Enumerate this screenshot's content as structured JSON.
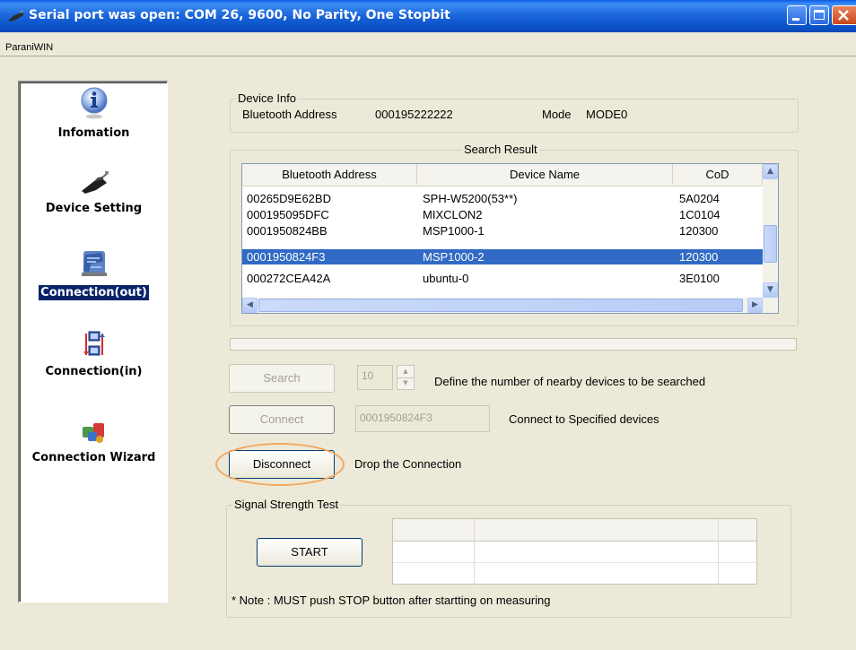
{
  "window": {
    "title": "Serial port was open: COM 26, 9600, No Parity, One Stopbit",
    "menu_item": "ParaniWIN"
  },
  "sidebar": {
    "items": [
      {
        "label": "Infomation",
        "icon": "info-icon"
      },
      {
        "label": "Device Setting",
        "icon": "device-icon"
      },
      {
        "label": "Connection(out)",
        "icon": "connection-out-icon",
        "active": true
      },
      {
        "label": "Connection(in)",
        "icon": "connection-in-icon"
      },
      {
        "label": "Connection Wizard",
        "icon": "wizard-icon"
      }
    ]
  },
  "device_info": {
    "legend": "Device Info",
    "address_label": "Bluetooth Address",
    "address_value": "000195222222",
    "mode_label": "Mode",
    "mode_value": "MODE0"
  },
  "search_result": {
    "legend": "Search Result",
    "columns": [
      "Bluetooth Address",
      "Device Name",
      "CoD"
    ],
    "rows": [
      {
        "address": "00265D9E62BD",
        "name": "SPH-W5200(53**)",
        "cod": "5A0204",
        "selected": false
      },
      {
        "address": "000195095DFC",
        "name": "MIXCLON2",
        "cod": "1C0104",
        "selected": false
      },
      {
        "address": "0001950824BB",
        "name": "MSP1000-1",
        "cod": "120300",
        "selected": false
      },
      {
        "address": "0001950824F3",
        "name": "MSP1000-2",
        "cod": "120300",
        "selected": true
      },
      {
        "address": "000272CEA42A",
        "name": "ubuntu-0",
        "cod": "3E0100",
        "selected": false
      }
    ]
  },
  "controls": {
    "search_label": "Search",
    "search_count": "10",
    "search_desc": "Define the number of nearby devices to be searched",
    "connect_label": "Connect",
    "connect_target": "0001950824F3",
    "connect_desc": "Connect to Specified devices",
    "disconnect_label": "Disconnect",
    "disconnect_desc": "Drop the Connection"
  },
  "signal": {
    "legend": "Signal Strength Test",
    "start_label": "START",
    "note": "* Note : MUST push STOP button after startting on measuring"
  },
  "colors": {
    "titlebar": "#0a52c9",
    "selection": "#316ac5",
    "sidebar_active": "#0a246a",
    "highlight_ring": "#f0a860"
  }
}
